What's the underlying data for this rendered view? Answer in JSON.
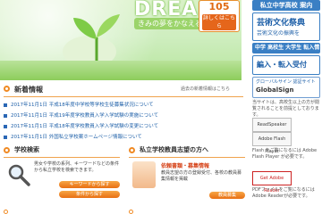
{
  "hero": {
    "dream_word": "DREAM",
    "dream_sub": "きみの夢をかなえる!",
    "badge_number": "105",
    "badge_detail": "詳しくはこちら"
  },
  "news": {
    "title": "新着情報",
    "more_link": "過去の新着情報はこちら",
    "items": [
      "2017年11月1日 平成18年度中学校等学校生徒募集状況について",
      "2017年11月1日 平成19年度学校教員入学入学試験の実施について",
      "2017年11月1日 平成18年度学校教員入学入学試験の変更について",
      "2017年11月1日 外国私立学校案ホームページ情報について"
    ]
  },
  "card_search": {
    "title": "学校検索",
    "desc": "男女や学校の系列、キーワードなどの条件から私立学校を検索できます。",
    "button1": "キーワードから探す",
    "button2": "条件から探す"
  },
  "card_jobs": {
    "title": "私立学校教員志望の方へ",
    "tag": "依頼書類・募集情報",
    "desc": "教員志望の方の登録受付、各校の教員募集情報を掲載",
    "button1": "教員募集"
  },
  "right": {
    "banner1": "私立中学高校 案内",
    "banner2_title": "芸術文化祭典",
    "banner2_sub": "芸術文化の振興を",
    "banner3": "中学 高校生 大学生 転入情報",
    "banner4_title": "編入・転入受付",
    "banner5_title": "グローバルサイン 認証サイト",
    "banner5_sub": "GlobalSign",
    "text1": "当サイトは、高校生以上の方が閲覧されることを前提としております。",
    "box1": "ReadSpeaker",
    "box2": "Adobe Flash Player",
    "text2": "Flash をご覧になるには Adobe Flash Player が必要です。",
    "pdf_label": "Get Adobe Reader",
    "text3": "PDFファイルをご覧になるにはAdobe Readerが必要です。"
  },
  "colors": {
    "accent_orange": "#f08a24",
    "link_blue": "#1d5fa8",
    "hero_green": "#b7e59d"
  }
}
